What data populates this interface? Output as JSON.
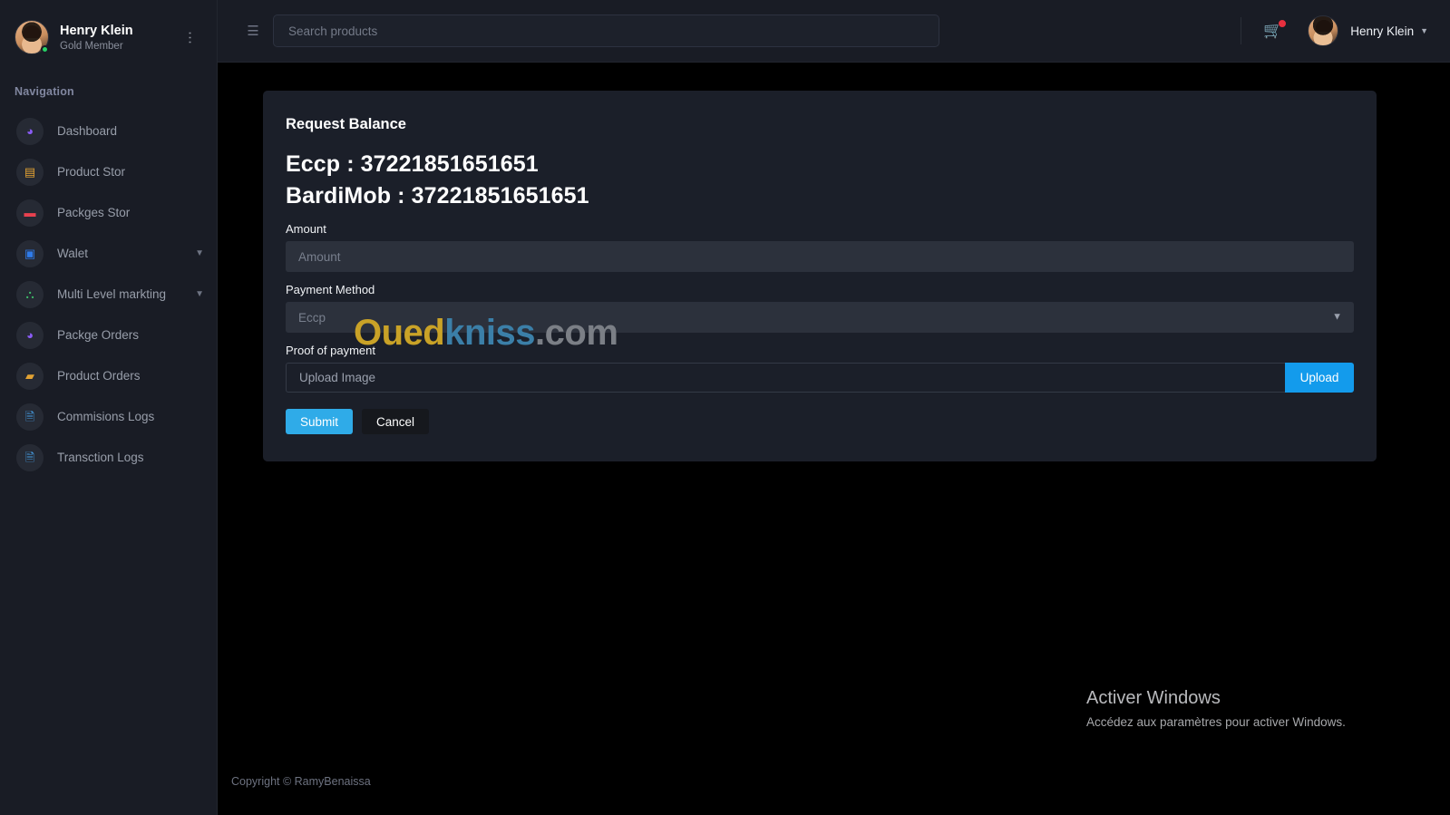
{
  "sidebar": {
    "profile": {
      "name": "Henry Klein",
      "role": "Gold Member",
      "menu_icon": "kebab-menu-icon",
      "avatar_icon": "user-avatar"
    },
    "nav_heading": "Navigation",
    "items": [
      {
        "label": "Dashboard",
        "icon": "speedometer-icon",
        "glyph": "◕",
        "color": "#8b5cf6",
        "has_chevron": false
      },
      {
        "label": "Product Stor",
        "icon": "store-icon",
        "glyph": "▤",
        "color": "#e2a233",
        "has_chevron": false
      },
      {
        "label": "Packges Stor",
        "icon": "card-icon",
        "glyph": "▬",
        "color": "#e8414f",
        "has_chevron": false
      },
      {
        "label": "Walet",
        "icon": "wallet-icon",
        "glyph": "▣",
        "color": "#2f7bea",
        "has_chevron": true
      },
      {
        "label": "Multi Level markting",
        "icon": "network-icon",
        "glyph": "⛬",
        "color": "#3fbf6a",
        "has_chevron": true
      },
      {
        "label": "Packge Orders",
        "icon": "speedometer-icon",
        "glyph": "◕",
        "color": "#8b5cf6",
        "has_chevron": false
      },
      {
        "label": "Product Orders",
        "icon": "truck-icon",
        "glyph": "▰",
        "color": "#e2a233",
        "has_chevron": false
      },
      {
        "label": "Commisions Logs",
        "icon": "document-icon",
        "glyph": "🗎",
        "color": "#46a0e8",
        "has_chevron": false
      },
      {
        "label": "Transction Logs",
        "icon": "document-icon",
        "glyph": "🗎",
        "color": "#46a0e8",
        "has_chevron": false
      }
    ]
  },
  "topbar": {
    "menu_toggle_icon": "hamburger-icon",
    "search": {
      "placeholder": "Search products",
      "value": ""
    },
    "cart_icon": "shopping-cart-icon",
    "cart_badge": "",
    "user": {
      "name": "Henry Klein",
      "caret_icon": "caret-down-icon"
    }
  },
  "card": {
    "title": "Request Balance",
    "accounts": [
      "Eccp : 37221851651651",
      "BardiMob : 37221851651651"
    ],
    "amount": {
      "label": "Amount",
      "placeholder": "Amount",
      "value": ""
    },
    "payment_method": {
      "label": "Payment Method",
      "selected": "Eccp",
      "options": [
        "Eccp",
        "BardiMob"
      ],
      "chevron_icon": "chevron-down-icon"
    },
    "proof": {
      "label": "Proof of payment",
      "placeholder": "Upload Image",
      "value": "",
      "upload_button": "Upload"
    },
    "buttons": {
      "submit": "Submit",
      "cancel": "Cancel"
    }
  },
  "watermark": {
    "part1": "Oued",
    "part2": "kniss",
    "part3": ".com"
  },
  "activate_windows": {
    "title": "Activer Windows",
    "subtitle": "Accédez aux paramètres pour activer Windows."
  },
  "footer": {
    "copyright": "Copyright © RamyBenaissa"
  },
  "colors": {
    "accent_blue": "#2fabe8",
    "upload_blue": "#139bec",
    "sidebar_bg": "#191c25",
    "card_bg": "#1b1f29",
    "page_bg": "#000000",
    "badge_red": "#e8303f",
    "online_green": "#25d366"
  }
}
